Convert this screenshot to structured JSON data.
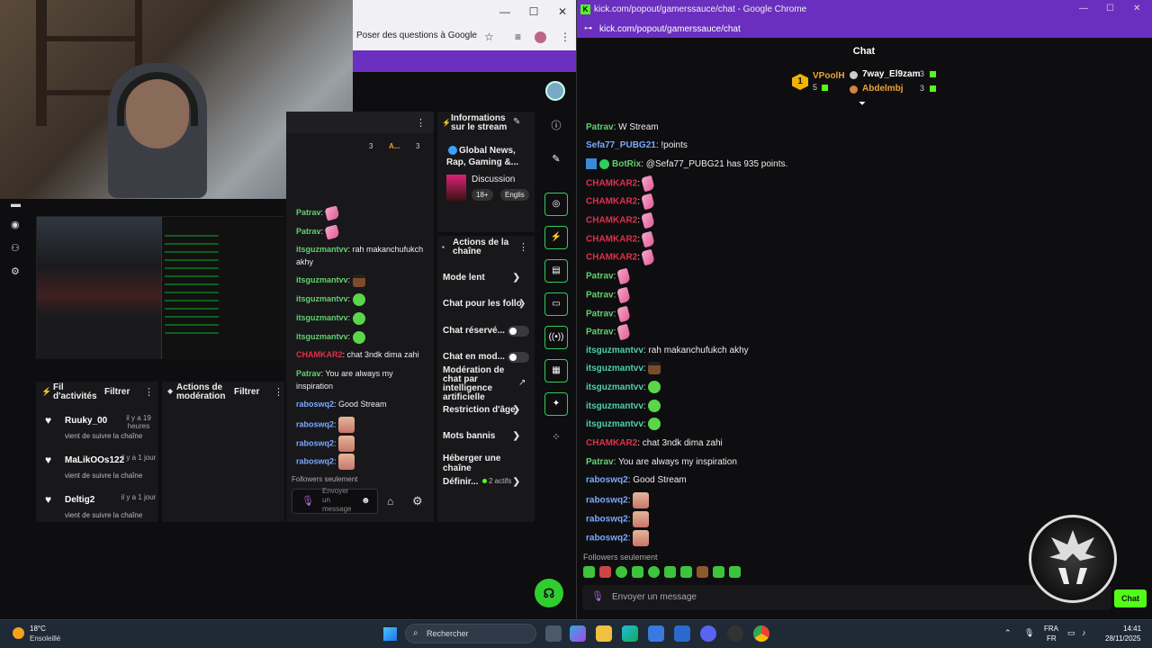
{
  "left_browser": {
    "ask_google": "Poser des questions à Google",
    "min": "—",
    "max": "☐",
    "close": "✕"
  },
  "activity": {
    "title": "Fil d'activités",
    "filter": "Filtrer",
    "items": [
      {
        "user": "Ruuky_00",
        "time": "il y a 19 heures",
        "desc": "vient de suivre la chaîne"
      },
      {
        "user": "MaLikOOs122",
        "time": "il y a 1 jour",
        "desc": "vient de suivre la chaîne"
      },
      {
        "user": "Deltig2",
        "time": "il y a 1 jour",
        "desc": "vient de suivre la chaîne"
      }
    ]
  },
  "mod_actions": {
    "title": "Actions de modération",
    "filter": "Filtrer"
  },
  "mid_chat": {
    "header_count_1": "3",
    "header_name_2": "A...",
    "header_count_2": "3",
    "messages": [
      {
        "user": "Patrav",
        "text": ""
      },
      {
        "user": "Patrav",
        "text": ""
      },
      {
        "user": "itsguzmantvv",
        "text": "rah makanchufukch akhy"
      },
      {
        "user": "itsguzmantvv",
        "text": ""
      },
      {
        "user": "itsguzmantvv",
        "text": ""
      },
      {
        "user": "itsguzmantvv",
        "text": ""
      },
      {
        "user": "itsguzmantvv",
        "text": ""
      },
      {
        "user": "CHAMKAR2",
        "text": "chat 3ndk dima zahi"
      },
      {
        "user": "Patrav",
        "text": "You are always my inspiration"
      },
      {
        "user": "raboswq2",
        "text": "Good Stream"
      },
      {
        "user": "raboswq2",
        "text": ""
      },
      {
        "user": "raboswq2",
        "text": ""
      },
      {
        "user": "raboswq2",
        "text": ""
      }
    ],
    "followers_only": "Followers seulement",
    "input_placeholder": "Envoyer un message"
  },
  "stream_info": {
    "title": "Informations sur le stream",
    "stream_title": "Global News, Rap, Gaming &...",
    "category": "Discussion",
    "tag_age": "18+",
    "tag_lang": "Englis"
  },
  "channel_actions": {
    "title": "Actions de la chaîne",
    "items": {
      "slow": "Mode lent",
      "followers": "Chat pour les follo",
      "reserved": "Chat réservé...",
      "mod_mode": "Chat en mod...",
      "ai_mod": "Modération de chat par intelligence artificielle",
      "age": "Restriction d'âge",
      "banned": "Mots bannis",
      "host": "Héberger une chaîne",
      "define": "Définir...",
      "define_badge": "2 actifs"
    }
  },
  "right_browser": {
    "title": "kick.com/popout/gamerssauce/chat - Google Chrome",
    "address": "kick.com/popout/gamerssauce/chat",
    "favicon": "K"
  },
  "chat": {
    "title": "Chat",
    "leaderboard": {
      "rank": "1",
      "first_user": "VPoolH",
      "first_count": "5",
      "second_user": "7way_El9zam",
      "second_count": "3",
      "third_user": "Abdelmbj",
      "third_count": "3"
    },
    "messages": [
      {
        "user": "Patrav",
        "color": "#63d06f",
        "text": "W Stream"
      },
      {
        "user": "Sefa77_PUBG21",
        "color": "#7aa8ff",
        "text": "!points"
      },
      {
        "user": "BotRix",
        "color": "#63d06f",
        "text": "@Sefa77_PUBG21 has 935 points."
      },
      {
        "user": "CHAMKAR2",
        "color": "#e0304a",
        "text": ""
      },
      {
        "user": "CHAMKAR2",
        "color": "#e0304a",
        "text": ""
      },
      {
        "user": "CHAMKAR2",
        "color": "#e0304a",
        "text": ""
      },
      {
        "user": "CHAMKAR2",
        "color": "#e0304a",
        "text": ""
      },
      {
        "user": "CHAMKAR2",
        "color": "#e0304a",
        "text": ""
      },
      {
        "user": "Patrav",
        "color": "#63d06f",
        "text": ""
      },
      {
        "user": "Patrav",
        "color": "#63d06f",
        "text": ""
      },
      {
        "user": "Patrav",
        "color": "#63d06f",
        "text": ""
      },
      {
        "user": "Patrav",
        "color": "#63d06f",
        "text": ""
      },
      {
        "user": "itsguzmantvv",
        "color": "#4fd0b0",
        "text": "rah makanchufukch akhy"
      },
      {
        "user": "itsguzmantvv",
        "color": "#4fd0b0",
        "text": ""
      },
      {
        "user": "itsguzmantvv",
        "color": "#4fd0b0",
        "text": ""
      },
      {
        "user": "itsguzmantvv",
        "color": "#4fd0b0",
        "text": ""
      },
      {
        "user": "itsguzmantvv",
        "color": "#4fd0b0",
        "text": ""
      },
      {
        "user": "CHAMKAR2",
        "color": "#e0304a",
        "text": "chat 3ndk dima zahi"
      },
      {
        "user": "Patrav",
        "color": "#63d06f",
        "text": "You are always my inspiration"
      },
      {
        "user": "raboswq2",
        "color": "#7aa8ff",
        "text": "Good Stream"
      },
      {
        "user": "raboswq2",
        "color": "#7aa8ff",
        "text": ""
      },
      {
        "user": "raboswq2",
        "color": "#7aa8ff",
        "text": ""
      },
      {
        "user": "raboswq2",
        "color": "#7aa8ff",
        "text": ""
      }
    ],
    "followers_only": "Followers seulement",
    "input_placeholder": "Envoyer un message",
    "send": "Chat"
  },
  "taskbar": {
    "temp": "18°C",
    "weather": "Ensoleillé",
    "search": "Rechercher",
    "lang1": "FRA",
    "lang2": "FR",
    "time": "14:41",
    "date": "28/11/2025"
  },
  "colors": {
    "kick_green": "#53fc18",
    "chrome_purple": "#6b2fbf"
  }
}
